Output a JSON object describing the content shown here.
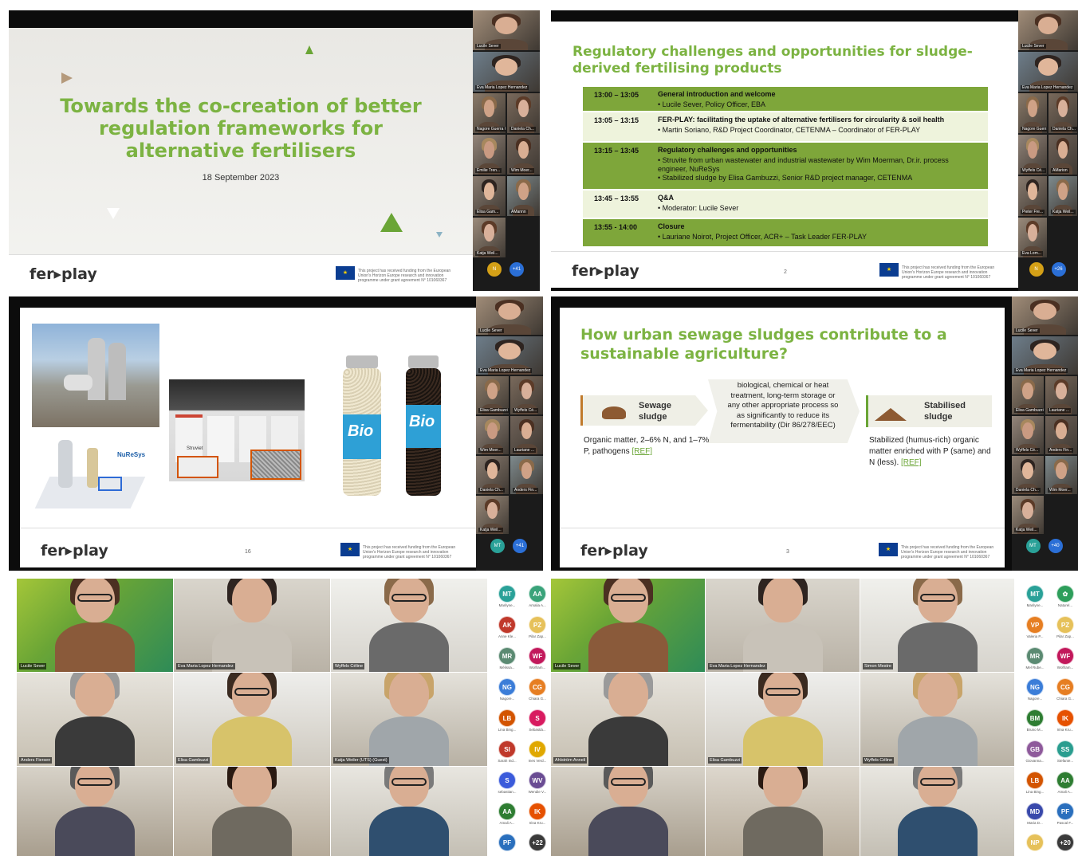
{
  "panel1": {
    "title": "Towards the co-creation of better regulation frameworks for alternative fertilisers",
    "date": "18 September 2023",
    "logo": "fer▸play",
    "eu_text": "This project has received funding from the European Union's Horizon Europe research and innovation programme under grant agreement N° 101060367",
    "participants": [
      "Lucile Sever",
      "Eva Maria Lopez Hernandez",
      "Nagore Guerra Gorostegi",
      "Daniela Ch...",
      "Emilie Tren...",
      "Wim Moer...",
      "Elisa Gam...",
      "AMannn",
      "Katja Weil..."
    ],
    "bubble_label": "N",
    "more": "+41"
  },
  "panel2": {
    "title": "Regulatory challenges and opportunities for sludge-derived fertilising products",
    "agenda": [
      {
        "time": "13:00 – 13:05",
        "line1": "General introduction and welcome",
        "line2": "•  Lucile Sever, Policy Officer, EBA",
        "line3": ""
      },
      {
        "time": "13:05 – 13:15",
        "line1": "FER-PLAY: facilitating the uptake of alternative fertilisers for circularity & soil health",
        "line2": "•  Martin Soriano, R&D Project Coordinator, CETENMA – Coordinator of FER-PLAY",
        "line3": ""
      },
      {
        "time": "13:15 – 13:45",
        "line1": "Regulatory challenges and opportunities",
        "line2": "•  Struvite from urban wastewater and industrial wastewater by Wim Moerman, Dr.ir. process engineer, NuReSys",
        "line3": "•  Stabilized sludge by Elisa Gambuzzi, Senior R&D project manager, CETENMA"
      },
      {
        "time": "13:45 – 13:55",
        "line1": "Q&A",
        "line2": "•  Moderator: Lucile Sever",
        "line3": ""
      },
      {
        "time": "13:55 - 14:00",
        "line1": "Closure",
        "line2": "•  Lauriane Noirot, Project Officer, ACR+ – Task Leader FER-PLAY",
        "line3": ""
      }
    ],
    "page": "2",
    "logo": "fer▸play",
    "participants": [
      "Lucile Sever",
      "Eva Maria Lopez Hernandez",
      "Nagore Guerra Gorostegi",
      "Daniela Ch...",
      "Wyffels Cé...",
      "AMarion",
      "Pieter Fre...",
      "Katja Weil...",
      "Eva Lom..."
    ],
    "bubble_label": "N",
    "more": "+26"
  },
  "panel3": {
    "labels": {
      "struviet": "Struviet",
      "nuresys": "NuReSys",
      "bottle1": "Bio",
      "bottle2": "Bio"
    },
    "page": "16",
    "logo": "fer▸play",
    "participants": [
      "Lucile Sever",
      "Eva Maria Lopez Hernandez",
      "Elisa Gambuzzi",
      "Wyffels Cé...",
      "Wim Moer...",
      "Lauriane ...",
      "Daniela Ch...",
      "Anders Fin...",
      "Katja Weil..."
    ],
    "bubble_label": "MT",
    "more": "+41"
  },
  "panel4": {
    "title": "How urban sewage sludges contribute to a sustainable agriculture?",
    "box1": "Sewage sludge",
    "box1_text": "Organic matter, 2–6% N, and 1–7% P, pathogens",
    "ref1": "[REF]",
    "process": "biological, chemical or heat treatment, long-term storage or any other appropriate process so as significantly to reduce its fermentability (Dir 86/278/EEC)",
    "box2": "Stabilised sludge",
    "box2_text": "Stabilized (humus-rich) organic matter enriched with P (same) and N (less).",
    "ref2": "[REF]",
    "page": "3",
    "logo": "fer▸play",
    "participants": [
      "Lucile Sever",
      "Eva Maria Lopez Hernandez",
      "Elisa Gambuzzi",
      "Lauriane ...",
      "Wyffels Cé...",
      "Anders Fin...",
      "Daniela Ch...",
      "Wim Moer...",
      "Katja Weil..."
    ],
    "bubble_label": "MT",
    "more": "+40"
  },
  "panel5": {
    "tiles": [
      "Lucile Sever",
      "Eva Maria Lopez Hernandez",
      "Wyffels Céline",
      "Anders Fiersen",
      "Elisa Gambuzzi",
      "Katja Weiler (UTS) (Guest)",
      "",
      "",
      ""
    ],
    "bubbles": [
      {
        "i": "MT",
        "l": "Marilyne...",
        "c": "#2aa198"
      },
      {
        "i": "AA",
        "l": "Amalia A...",
        "c": "#3aa37a"
      },
      {
        "i": "AK",
        "l": "Anne Kle...",
        "c": "#c0392b"
      },
      {
        "i": "PZ",
        "l": "Pilar Zap...",
        "c": "#e6c15a"
      },
      {
        "i": "MR",
        "l": "Mélissa...",
        "c": "#5b8a72"
      },
      {
        "i": "WF",
        "l": "Wolfram...",
        "c": "#c2185b"
      },
      {
        "i": "NG",
        "l": "Nagore...",
        "c": "#3b7dd8"
      },
      {
        "i": "CG",
        "l": "Chiara G...",
        "c": "#e67e22"
      },
      {
        "i": "LB",
        "l": "Lina Bing...",
        "c": "#d35400"
      },
      {
        "i": "S",
        "l": "Sebastiá...",
        "c": "#d81b60"
      },
      {
        "i": "SI",
        "l": "Sarah Ind...",
        "c": "#c0392b"
      },
      {
        "i": "IV",
        "l": "Ines Verd...",
        "c": "#e0a800"
      },
      {
        "i": "S",
        "l": "sebastian...",
        "c": "#3b5bdb"
      },
      {
        "i": "WV",
        "l": "Wendie V...",
        "c": "#6a4c93"
      },
      {
        "i": "AA",
        "l": "Amali A...",
        "c": "#2e7d32"
      },
      {
        "i": "IK",
        "l": "Irina Kru...",
        "c": "#e65100"
      },
      {
        "i": "PF",
        "l": "",
        "c": "#2a6fbd"
      },
      {
        "i": "+22",
        "l": "",
        "c": "#3a3a3a"
      }
    ]
  },
  "panel6": {
    "tiles": [
      "Lucile Sever",
      "Eva Maria Lopez Hernandez",
      "Simon Mestre",
      "Ahlström Anneli",
      "Elisa Gambuzzi",
      "Wyffels Céline",
      "",
      "",
      ""
    ],
    "bubbles": [
      {
        "i": "MT",
        "l": "Marilyne...",
        "c": "#2aa198"
      },
      {
        "i": "✿",
        "l": "Naturel...",
        "c": "#2e9e5b"
      },
      {
        "i": "VP",
        "l": "Valeria P...",
        "c": "#e67e22"
      },
      {
        "i": "PZ",
        "l": "Pilar Zap...",
        "c": "#e6c15a"
      },
      {
        "i": "MR",
        "l": "Mel Rube...",
        "c": "#5b8a72"
      },
      {
        "i": "WF",
        "l": "Wolfram...",
        "c": "#c2185b"
      },
      {
        "i": "NG",
        "l": "Nagore...",
        "c": "#3b7dd8"
      },
      {
        "i": "CG",
        "l": "Chiara G...",
        "c": "#e67e22"
      },
      {
        "i": "BM",
        "l": "Bruno M...",
        "c": "#2e7d32"
      },
      {
        "i": "IK",
        "l": "Irina Kru...",
        "c": "#e65100"
      },
      {
        "i": "GB",
        "l": "Giovanna...",
        "c": "#8e5a9b"
      },
      {
        "i": "SS",
        "l": "Stefanie...",
        "c": "#2a9d8f"
      },
      {
        "i": "LB",
        "l": "Lina Bing...",
        "c": "#d35400"
      },
      {
        "i": "AA",
        "l": "Amali A...",
        "c": "#2e7d32"
      },
      {
        "i": "MD",
        "l": "Maria D...",
        "c": "#3949ab"
      },
      {
        "i": "PF",
        "l": "Pascal F...",
        "c": "#2a6fbd"
      },
      {
        "i": "NP",
        "l": "",
        "c": "#e6c15a"
      },
      {
        "i": "+20",
        "l": "",
        "c": "#3a3a3a"
      }
    ]
  }
}
